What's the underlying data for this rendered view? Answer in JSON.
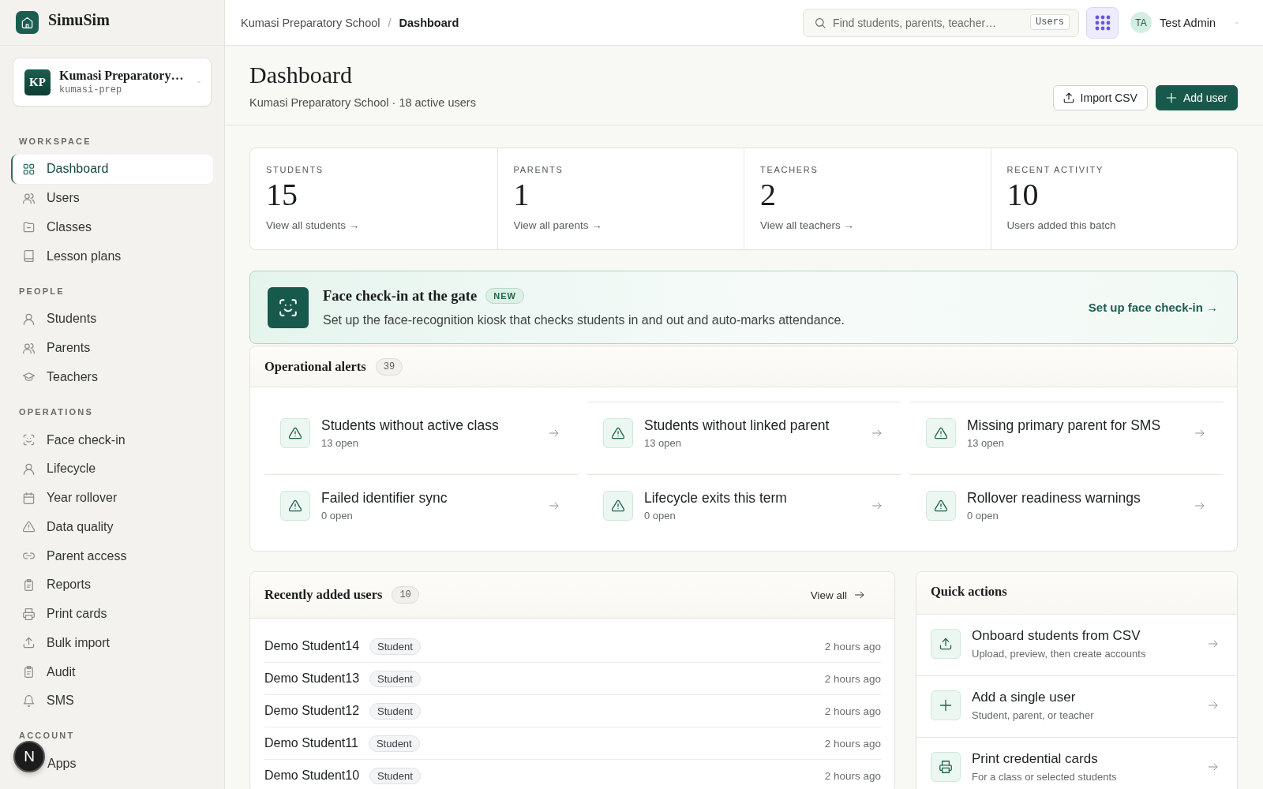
{
  "sidebar": {
    "brand": {
      "name": "SimuSim"
    },
    "workspace": {
      "initials": "KP",
      "name": "Kumasi Preparatory…",
      "slug": "kumasi-prep"
    },
    "sections": [
      {
        "title": "WORKSPACE",
        "items": [
          {
            "label": "Dashboard",
            "selected": true
          },
          {
            "label": "Users",
            "selected": false
          },
          {
            "label": "Classes",
            "selected": false
          },
          {
            "label": "Lesson plans",
            "selected": false
          }
        ]
      },
      {
        "title": "PEOPLE",
        "items": [
          {
            "label": "Students",
            "selected": false
          },
          {
            "label": "Parents",
            "selected": false
          },
          {
            "label": "Teachers",
            "selected": false
          }
        ]
      },
      {
        "title": "OPERATIONS",
        "items": [
          {
            "label": "Face check-in",
            "selected": false
          },
          {
            "label": "Lifecycle",
            "selected": false
          },
          {
            "label": "Year rollover",
            "selected": false
          },
          {
            "label": "Data quality",
            "selected": false
          },
          {
            "label": "Parent access",
            "selected": false
          },
          {
            "label": "Reports",
            "selected": false
          },
          {
            "label": "Print cards",
            "selected": false
          },
          {
            "label": "Bulk import",
            "selected": false
          },
          {
            "label": "Audit",
            "selected": false
          },
          {
            "label": "SMS",
            "selected": false
          }
        ]
      },
      {
        "title": "ACCOUNT",
        "items": [
          {
            "label": "Apps",
            "selected": false
          }
        ]
      }
    ]
  },
  "dev_indicator": {
    "label": "N"
  },
  "topbar": {
    "breadcrumb": [
      {
        "label": "Kumasi Preparatory School",
        "current": false
      },
      {
        "label": "Dashboard",
        "current": true
      }
    ],
    "separator": "/",
    "search": {
      "placeholder": "Find students, parents, teacher…",
      "scope": "Users"
    },
    "user": {
      "initials": "TA",
      "name": "Test Admin"
    }
  },
  "page_header": {
    "title": "Dashboard",
    "subtitle": "Kumasi Preparatory School · 18 active users",
    "actions": [
      {
        "label": "Import CSV",
        "kind": "secondary"
      },
      {
        "label": "Add user",
        "kind": "primary"
      }
    ]
  },
  "stats": [
    {
      "label": "STUDENTS",
      "value": "15",
      "link": "View all students →"
    },
    {
      "label": "PARENTS",
      "value": "1",
      "link": "View all parents →"
    },
    {
      "label": "TEACHERS",
      "value": "2",
      "link": "View all teachers →"
    },
    {
      "label": "RECENT ACTIVITY",
      "value": "10",
      "caption": "Users added this batch"
    }
  ],
  "banner": {
    "title": "Face check-in at the gate",
    "badge": "NEW",
    "description": "Set up the face-recognition kiosk that checks students in and out and auto-marks attendance.",
    "action": "Set up face check-in →"
  },
  "alerts": {
    "title": "Operational alerts",
    "count": "39",
    "items": [
      {
        "title": "Students without active class",
        "status": "13 open"
      },
      {
        "title": "Students without linked parent",
        "status": "13 open"
      },
      {
        "title": "Missing primary parent for SMS",
        "status": "13 open"
      },
      {
        "title": "Failed identifier sync",
        "status": "0 open"
      },
      {
        "title": "Lifecycle exits this term",
        "status": "0 open"
      },
      {
        "title": "Rollover readiness warnings",
        "status": "0 open"
      }
    ]
  },
  "recent_users": {
    "title": "Recently added users",
    "count": "10",
    "view_all": "View all",
    "rows": [
      {
        "name": "Demo Student14",
        "role": "Student",
        "time": "2 hours ago"
      },
      {
        "name": "Demo Student13",
        "role": "Student",
        "time": "2 hours ago"
      },
      {
        "name": "Demo Student12",
        "role": "Student",
        "time": "2 hours ago"
      },
      {
        "name": "Demo Student11",
        "role": "Student",
        "time": "2 hours ago"
      },
      {
        "name": "Demo Student10",
        "role": "Student",
        "time": "2 hours ago"
      }
    ]
  },
  "quick_actions": {
    "title": "Quick actions",
    "items": [
      {
        "title": "Onboard students from CSV",
        "description": "Upload, preview, then create accounts"
      },
      {
        "title": "Add a single user",
        "description": "Student, parent, or teacher"
      },
      {
        "title": "Print credential cards",
        "description": "For a class or selected students"
      }
    ]
  }
}
